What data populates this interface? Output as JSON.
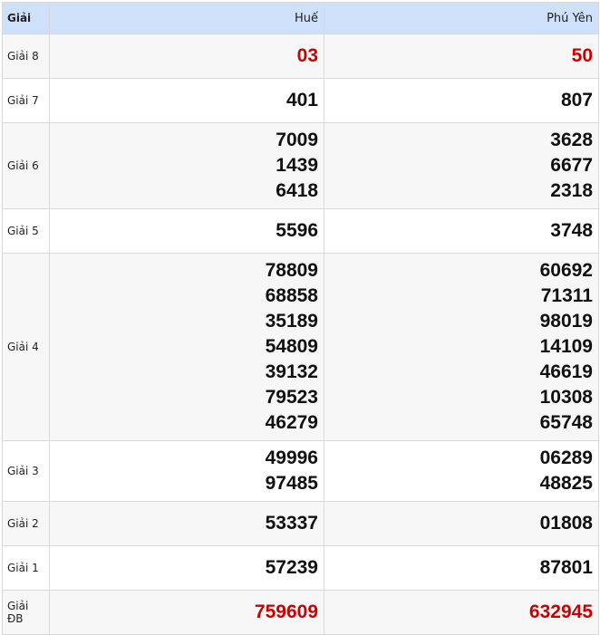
{
  "header": {
    "prize_col": "Giải",
    "provinces": [
      "Huế",
      "Phú Yên"
    ]
  },
  "rows": [
    {
      "label": "Giải 8",
      "hue": [
        "03"
      ],
      "phuyen": [
        "50"
      ],
      "highlight": true
    },
    {
      "label": "Giải 7",
      "hue": [
        "401"
      ],
      "phuyen": [
        "807"
      ]
    },
    {
      "label": "Giải 6",
      "hue": [
        "7009",
        "1439",
        "6418"
      ],
      "phuyen": [
        "3628",
        "6677",
        "2318"
      ]
    },
    {
      "label": "Giải 5",
      "hue": [
        "5596"
      ],
      "phuyen": [
        "3748"
      ]
    },
    {
      "label": "Giải 4",
      "hue": [
        "78809",
        "68858",
        "35189",
        "54809",
        "39132",
        "79523",
        "46279"
      ],
      "phuyen": [
        "60692",
        "71311",
        "98019",
        "14109",
        "46619",
        "10308",
        "65748"
      ]
    },
    {
      "label": "Giải 3",
      "hue": [
        "49996",
        "97485"
      ],
      "phuyen": [
        "06289",
        "48825"
      ]
    },
    {
      "label": "Giải 2",
      "hue": [
        "53337"
      ],
      "phuyen": [
        "01808"
      ]
    },
    {
      "label": "Giải 1",
      "hue": [
        "57239"
      ],
      "phuyen": [
        "87801"
      ]
    },
    {
      "label": "Giải ĐB",
      "hue": [
        "759609"
      ],
      "phuyen": [
        "632945"
      ],
      "highlight": true
    }
  ],
  "colors": {
    "header_bg": "#cfe0fb",
    "highlight": "#cc0000",
    "alt_row": "#f7f7f7"
  }
}
